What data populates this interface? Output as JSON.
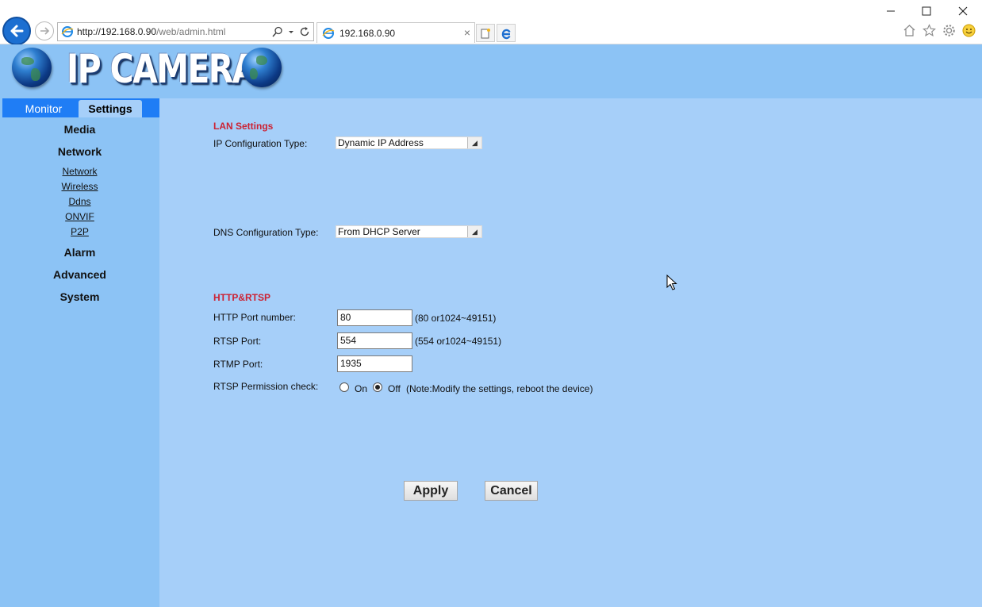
{
  "browser": {
    "url_prefix": "http://192.168.0.90",
    "url_path": "/web/admin.html",
    "tab_title": "192.168.0.90",
    "tab_close": "×"
  },
  "banner": {
    "title": "IP CAMERA"
  },
  "sidebar": {
    "tabs": [
      {
        "label": "Monitor"
      },
      {
        "label": "Settings"
      }
    ],
    "sections": {
      "media": "Media",
      "network": "Network",
      "alarm": "Alarm",
      "advanced": "Advanced",
      "system": "System"
    },
    "network_links": [
      "Network",
      "Wireless",
      "Ddns",
      "ONVIF",
      "P2P"
    ]
  },
  "lan": {
    "heading": "LAN Settings",
    "ip_config_label": "IP Configuration Type:",
    "ip_config_value": "Dynamic IP Address",
    "dns_config_label": "DNS Configuration Type:",
    "dns_config_value": "From DHCP Server"
  },
  "http": {
    "heading": "HTTP&RTSP",
    "http_port_label": "HTTP Port number:",
    "http_port_value": "80",
    "http_port_hint": "(80 or1024~49151)",
    "rtsp_port_label": "RTSP Port:",
    "rtsp_port_value": "554",
    "rtsp_port_hint": "(554 or1024~49151)",
    "rtmp_port_label": "RTMP Port:",
    "rtmp_port_value": "1935",
    "permission_label": "RTSP Permission check:",
    "permission_on": "On",
    "permission_off": "Off",
    "permission_selected": "Off",
    "permission_note": "(Note:Modify the settings, reboot the device)"
  },
  "buttons": {
    "apply": "Apply",
    "cancel": "Cancel"
  },
  "colors": {
    "page_bg": "#a6cff9",
    "banner_bg": "#8cc3f5",
    "tab_active_bar": "#1f7df5",
    "heading_red": "#cc2233"
  }
}
